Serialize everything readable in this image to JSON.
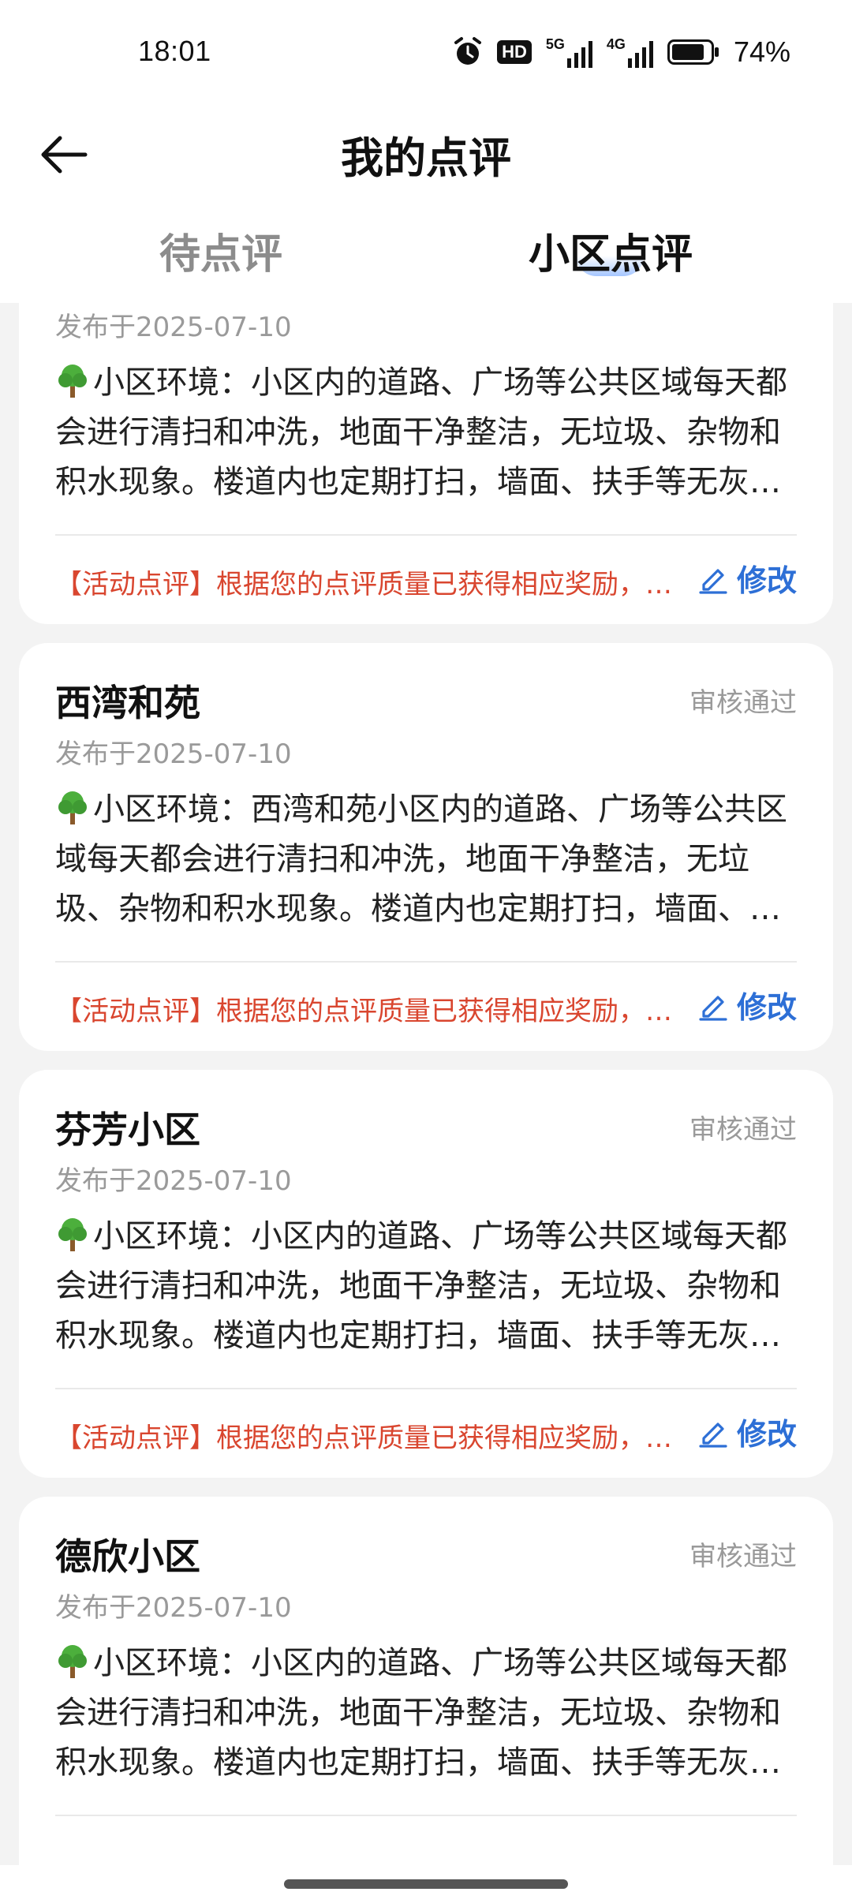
{
  "status_bar": {
    "time": "18:01",
    "battery_percent": "74%",
    "hd_label": "HD",
    "network_5g": "5G",
    "network_4g": "4G"
  },
  "header": {
    "title": "我的点评"
  },
  "tabs": [
    {
      "label": "待点评",
      "active": false
    },
    {
      "label": "小区点评",
      "active": true
    }
  ],
  "reviews": [
    {
      "name": "",
      "status": "",
      "date": "发布于2025-07-10",
      "text": "小区环境：小区内的道路、广场等公共区域每天都会进行清扫和冲洗，地面干净整洁，无垃圾、杂物和积水现象。楼道内也定期打扫，墙面、扶手等无灰…",
      "reward": "【活动点评】根据您的点评质量已获得相应奖励，…",
      "edit_label": "修改"
    },
    {
      "name": "西湾和苑",
      "status": "审核通过",
      "date": "发布于2025-07-10",
      "text": "小区环境：西湾和苑小区内的道路、广场等公共区域每天都会进行清扫和冲洗，地面干净整洁，无垃圾、杂物和积水现象。楼道内也定期打扫，墙面、…",
      "reward": "【活动点评】根据您的点评质量已获得相应奖励，…",
      "edit_label": "修改"
    },
    {
      "name": "芬芳小区",
      "status": "审核通过",
      "date": "发布于2025-07-10",
      "text": "小区环境：小区内的道路、广场等公共区域每天都会进行清扫和冲洗，地面干净整洁，无垃圾、杂物和积水现象。楼道内也定期打扫，墙面、扶手等无灰…",
      "reward": "【活动点评】根据您的点评质量已获得相应奖励，…",
      "edit_label": "修改"
    },
    {
      "name": "德欣小区",
      "status": "审核通过",
      "date": "发布于2025-07-10",
      "text": "小区环境：小区内的道路、广场等公共区域每天都会进行清扫和冲洗，地面干净整洁，无垃圾、杂物和积水现象。楼道内也定期打扫，墙面、扶手等无灰…",
      "reward": "",
      "edit_label": ""
    }
  ],
  "colors": {
    "accent_blue": "#2d6fd6",
    "reward_red": "#d9462f",
    "muted_gray": "#9a9a9a"
  },
  "icons": {
    "back": "arrow-left-icon",
    "edit": "pencil-icon",
    "environment": "tree-icon",
    "alarm": "alarm-clock-icon",
    "battery": "battery-icon"
  }
}
